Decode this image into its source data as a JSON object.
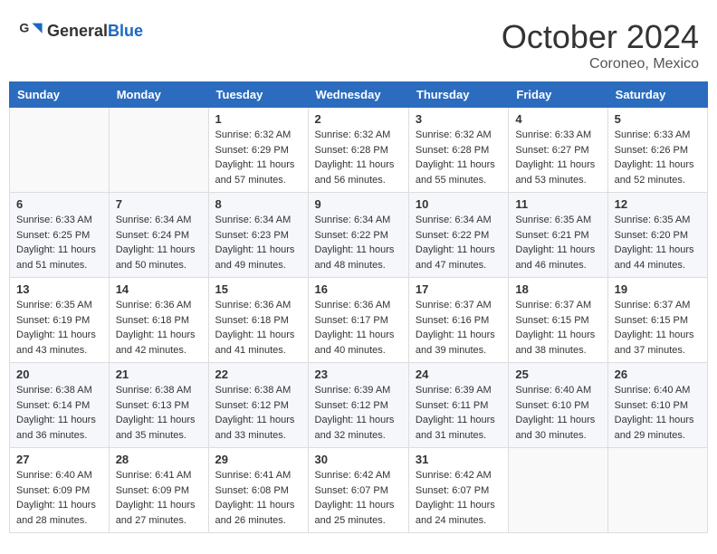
{
  "header": {
    "logo_general": "General",
    "logo_blue": "Blue",
    "month": "October 2024",
    "location": "Coroneo, Mexico"
  },
  "days_of_week": [
    "Sunday",
    "Monday",
    "Tuesday",
    "Wednesday",
    "Thursday",
    "Friday",
    "Saturday"
  ],
  "weeks": [
    [
      {
        "day": "",
        "sunrise": "",
        "sunset": "",
        "daylight": ""
      },
      {
        "day": "",
        "sunrise": "",
        "sunset": "",
        "daylight": ""
      },
      {
        "day": "1",
        "sunrise": "Sunrise: 6:32 AM",
        "sunset": "Sunset: 6:29 PM",
        "daylight": "Daylight: 11 hours and 57 minutes."
      },
      {
        "day": "2",
        "sunrise": "Sunrise: 6:32 AM",
        "sunset": "Sunset: 6:28 PM",
        "daylight": "Daylight: 11 hours and 56 minutes."
      },
      {
        "day": "3",
        "sunrise": "Sunrise: 6:32 AM",
        "sunset": "Sunset: 6:28 PM",
        "daylight": "Daylight: 11 hours and 55 minutes."
      },
      {
        "day": "4",
        "sunrise": "Sunrise: 6:33 AM",
        "sunset": "Sunset: 6:27 PM",
        "daylight": "Daylight: 11 hours and 53 minutes."
      },
      {
        "day": "5",
        "sunrise": "Sunrise: 6:33 AM",
        "sunset": "Sunset: 6:26 PM",
        "daylight": "Daylight: 11 hours and 52 minutes."
      }
    ],
    [
      {
        "day": "6",
        "sunrise": "Sunrise: 6:33 AM",
        "sunset": "Sunset: 6:25 PM",
        "daylight": "Daylight: 11 hours and 51 minutes."
      },
      {
        "day": "7",
        "sunrise": "Sunrise: 6:34 AM",
        "sunset": "Sunset: 6:24 PM",
        "daylight": "Daylight: 11 hours and 50 minutes."
      },
      {
        "day": "8",
        "sunrise": "Sunrise: 6:34 AM",
        "sunset": "Sunset: 6:23 PM",
        "daylight": "Daylight: 11 hours and 49 minutes."
      },
      {
        "day": "9",
        "sunrise": "Sunrise: 6:34 AM",
        "sunset": "Sunset: 6:22 PM",
        "daylight": "Daylight: 11 hours and 48 minutes."
      },
      {
        "day": "10",
        "sunrise": "Sunrise: 6:34 AM",
        "sunset": "Sunset: 6:22 PM",
        "daylight": "Daylight: 11 hours and 47 minutes."
      },
      {
        "day": "11",
        "sunrise": "Sunrise: 6:35 AM",
        "sunset": "Sunset: 6:21 PM",
        "daylight": "Daylight: 11 hours and 46 minutes."
      },
      {
        "day": "12",
        "sunrise": "Sunrise: 6:35 AM",
        "sunset": "Sunset: 6:20 PM",
        "daylight": "Daylight: 11 hours and 44 minutes."
      }
    ],
    [
      {
        "day": "13",
        "sunrise": "Sunrise: 6:35 AM",
        "sunset": "Sunset: 6:19 PM",
        "daylight": "Daylight: 11 hours and 43 minutes."
      },
      {
        "day": "14",
        "sunrise": "Sunrise: 6:36 AM",
        "sunset": "Sunset: 6:18 PM",
        "daylight": "Daylight: 11 hours and 42 minutes."
      },
      {
        "day": "15",
        "sunrise": "Sunrise: 6:36 AM",
        "sunset": "Sunset: 6:18 PM",
        "daylight": "Daylight: 11 hours and 41 minutes."
      },
      {
        "day": "16",
        "sunrise": "Sunrise: 6:36 AM",
        "sunset": "Sunset: 6:17 PM",
        "daylight": "Daylight: 11 hours and 40 minutes."
      },
      {
        "day": "17",
        "sunrise": "Sunrise: 6:37 AM",
        "sunset": "Sunset: 6:16 PM",
        "daylight": "Daylight: 11 hours and 39 minutes."
      },
      {
        "day": "18",
        "sunrise": "Sunrise: 6:37 AM",
        "sunset": "Sunset: 6:15 PM",
        "daylight": "Daylight: 11 hours and 38 minutes."
      },
      {
        "day": "19",
        "sunrise": "Sunrise: 6:37 AM",
        "sunset": "Sunset: 6:15 PM",
        "daylight": "Daylight: 11 hours and 37 minutes."
      }
    ],
    [
      {
        "day": "20",
        "sunrise": "Sunrise: 6:38 AM",
        "sunset": "Sunset: 6:14 PM",
        "daylight": "Daylight: 11 hours and 36 minutes."
      },
      {
        "day": "21",
        "sunrise": "Sunrise: 6:38 AM",
        "sunset": "Sunset: 6:13 PM",
        "daylight": "Daylight: 11 hours and 35 minutes."
      },
      {
        "day": "22",
        "sunrise": "Sunrise: 6:38 AM",
        "sunset": "Sunset: 6:12 PM",
        "daylight": "Daylight: 11 hours and 33 minutes."
      },
      {
        "day": "23",
        "sunrise": "Sunrise: 6:39 AM",
        "sunset": "Sunset: 6:12 PM",
        "daylight": "Daylight: 11 hours and 32 minutes."
      },
      {
        "day": "24",
        "sunrise": "Sunrise: 6:39 AM",
        "sunset": "Sunset: 6:11 PM",
        "daylight": "Daylight: 11 hours and 31 minutes."
      },
      {
        "day": "25",
        "sunrise": "Sunrise: 6:40 AM",
        "sunset": "Sunset: 6:10 PM",
        "daylight": "Daylight: 11 hours and 30 minutes."
      },
      {
        "day": "26",
        "sunrise": "Sunrise: 6:40 AM",
        "sunset": "Sunset: 6:10 PM",
        "daylight": "Daylight: 11 hours and 29 minutes."
      }
    ],
    [
      {
        "day": "27",
        "sunrise": "Sunrise: 6:40 AM",
        "sunset": "Sunset: 6:09 PM",
        "daylight": "Daylight: 11 hours and 28 minutes."
      },
      {
        "day": "28",
        "sunrise": "Sunrise: 6:41 AM",
        "sunset": "Sunset: 6:09 PM",
        "daylight": "Daylight: 11 hours and 27 minutes."
      },
      {
        "day": "29",
        "sunrise": "Sunrise: 6:41 AM",
        "sunset": "Sunset: 6:08 PM",
        "daylight": "Daylight: 11 hours and 26 minutes."
      },
      {
        "day": "30",
        "sunrise": "Sunrise: 6:42 AM",
        "sunset": "Sunset: 6:07 PM",
        "daylight": "Daylight: 11 hours and 25 minutes."
      },
      {
        "day": "31",
        "sunrise": "Sunrise: 6:42 AM",
        "sunset": "Sunset: 6:07 PM",
        "daylight": "Daylight: 11 hours and 24 minutes."
      },
      {
        "day": "",
        "sunrise": "",
        "sunset": "",
        "daylight": ""
      },
      {
        "day": "",
        "sunrise": "",
        "sunset": "",
        "daylight": ""
      }
    ]
  ]
}
